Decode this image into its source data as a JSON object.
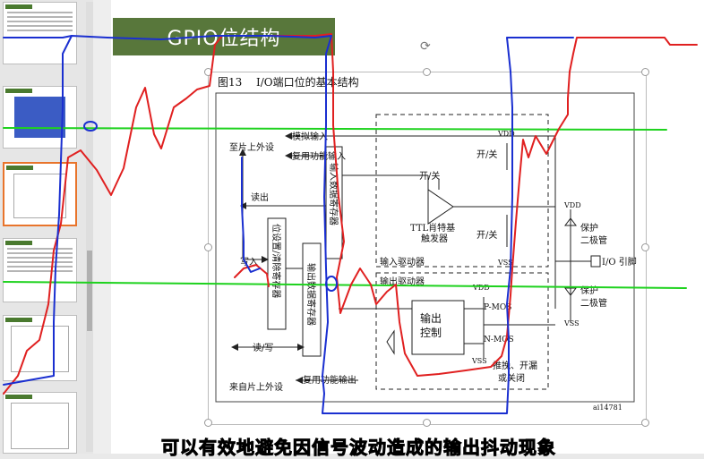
{
  "slide": {
    "title": "GPIO位结构"
  },
  "figure": {
    "caption_num": "图13",
    "caption_text": "I/O端口位的基本结构",
    "labels": {
      "analog_in": "模拟输入",
      "to_chip": "至片上外设",
      "alt_in": "复用功能输入",
      "read": "读出",
      "onoff_top": "开/关",
      "onoff_right_top": "开/关",
      "onoff_right_bottom": "开/关",
      "ttl": "TTL肖特基",
      "trigger": "触发器",
      "in_driver": "输入驱动器",
      "out_driver": "输出驱动器",
      "write": "写入",
      "bsrr": "位设置/清除寄存器",
      "idr": "输入数据寄存器",
      "odr": "输出数据寄存器",
      "read_write": "读/写",
      "from_chip": "来自片上外设",
      "alt_out": "复用功能输出",
      "out_ctrl1": "输出",
      "out_ctrl2": "控制",
      "pmos": "P-MOS",
      "nmos": "N-MOS",
      "vdd": "VDD",
      "vss": "VSS",
      "protect1": "保护",
      "diode1": "二极管",
      "protect2": "保护",
      "diode2": "二极管",
      "io_pin": "I/O 引脚",
      "pushpull": "推挽、开漏",
      "or_off": "或关闭",
      "ref": "ai14781"
    }
  },
  "subtitle": "可以有效地避免因信号波动造成的输出抖动现象",
  "colors": {
    "banner": "#58773b",
    "pen_red": "#e02020",
    "pen_blue": "#1a2fd0",
    "pen_green": "#1ed21e",
    "selected_thumb": "#e8742b"
  }
}
